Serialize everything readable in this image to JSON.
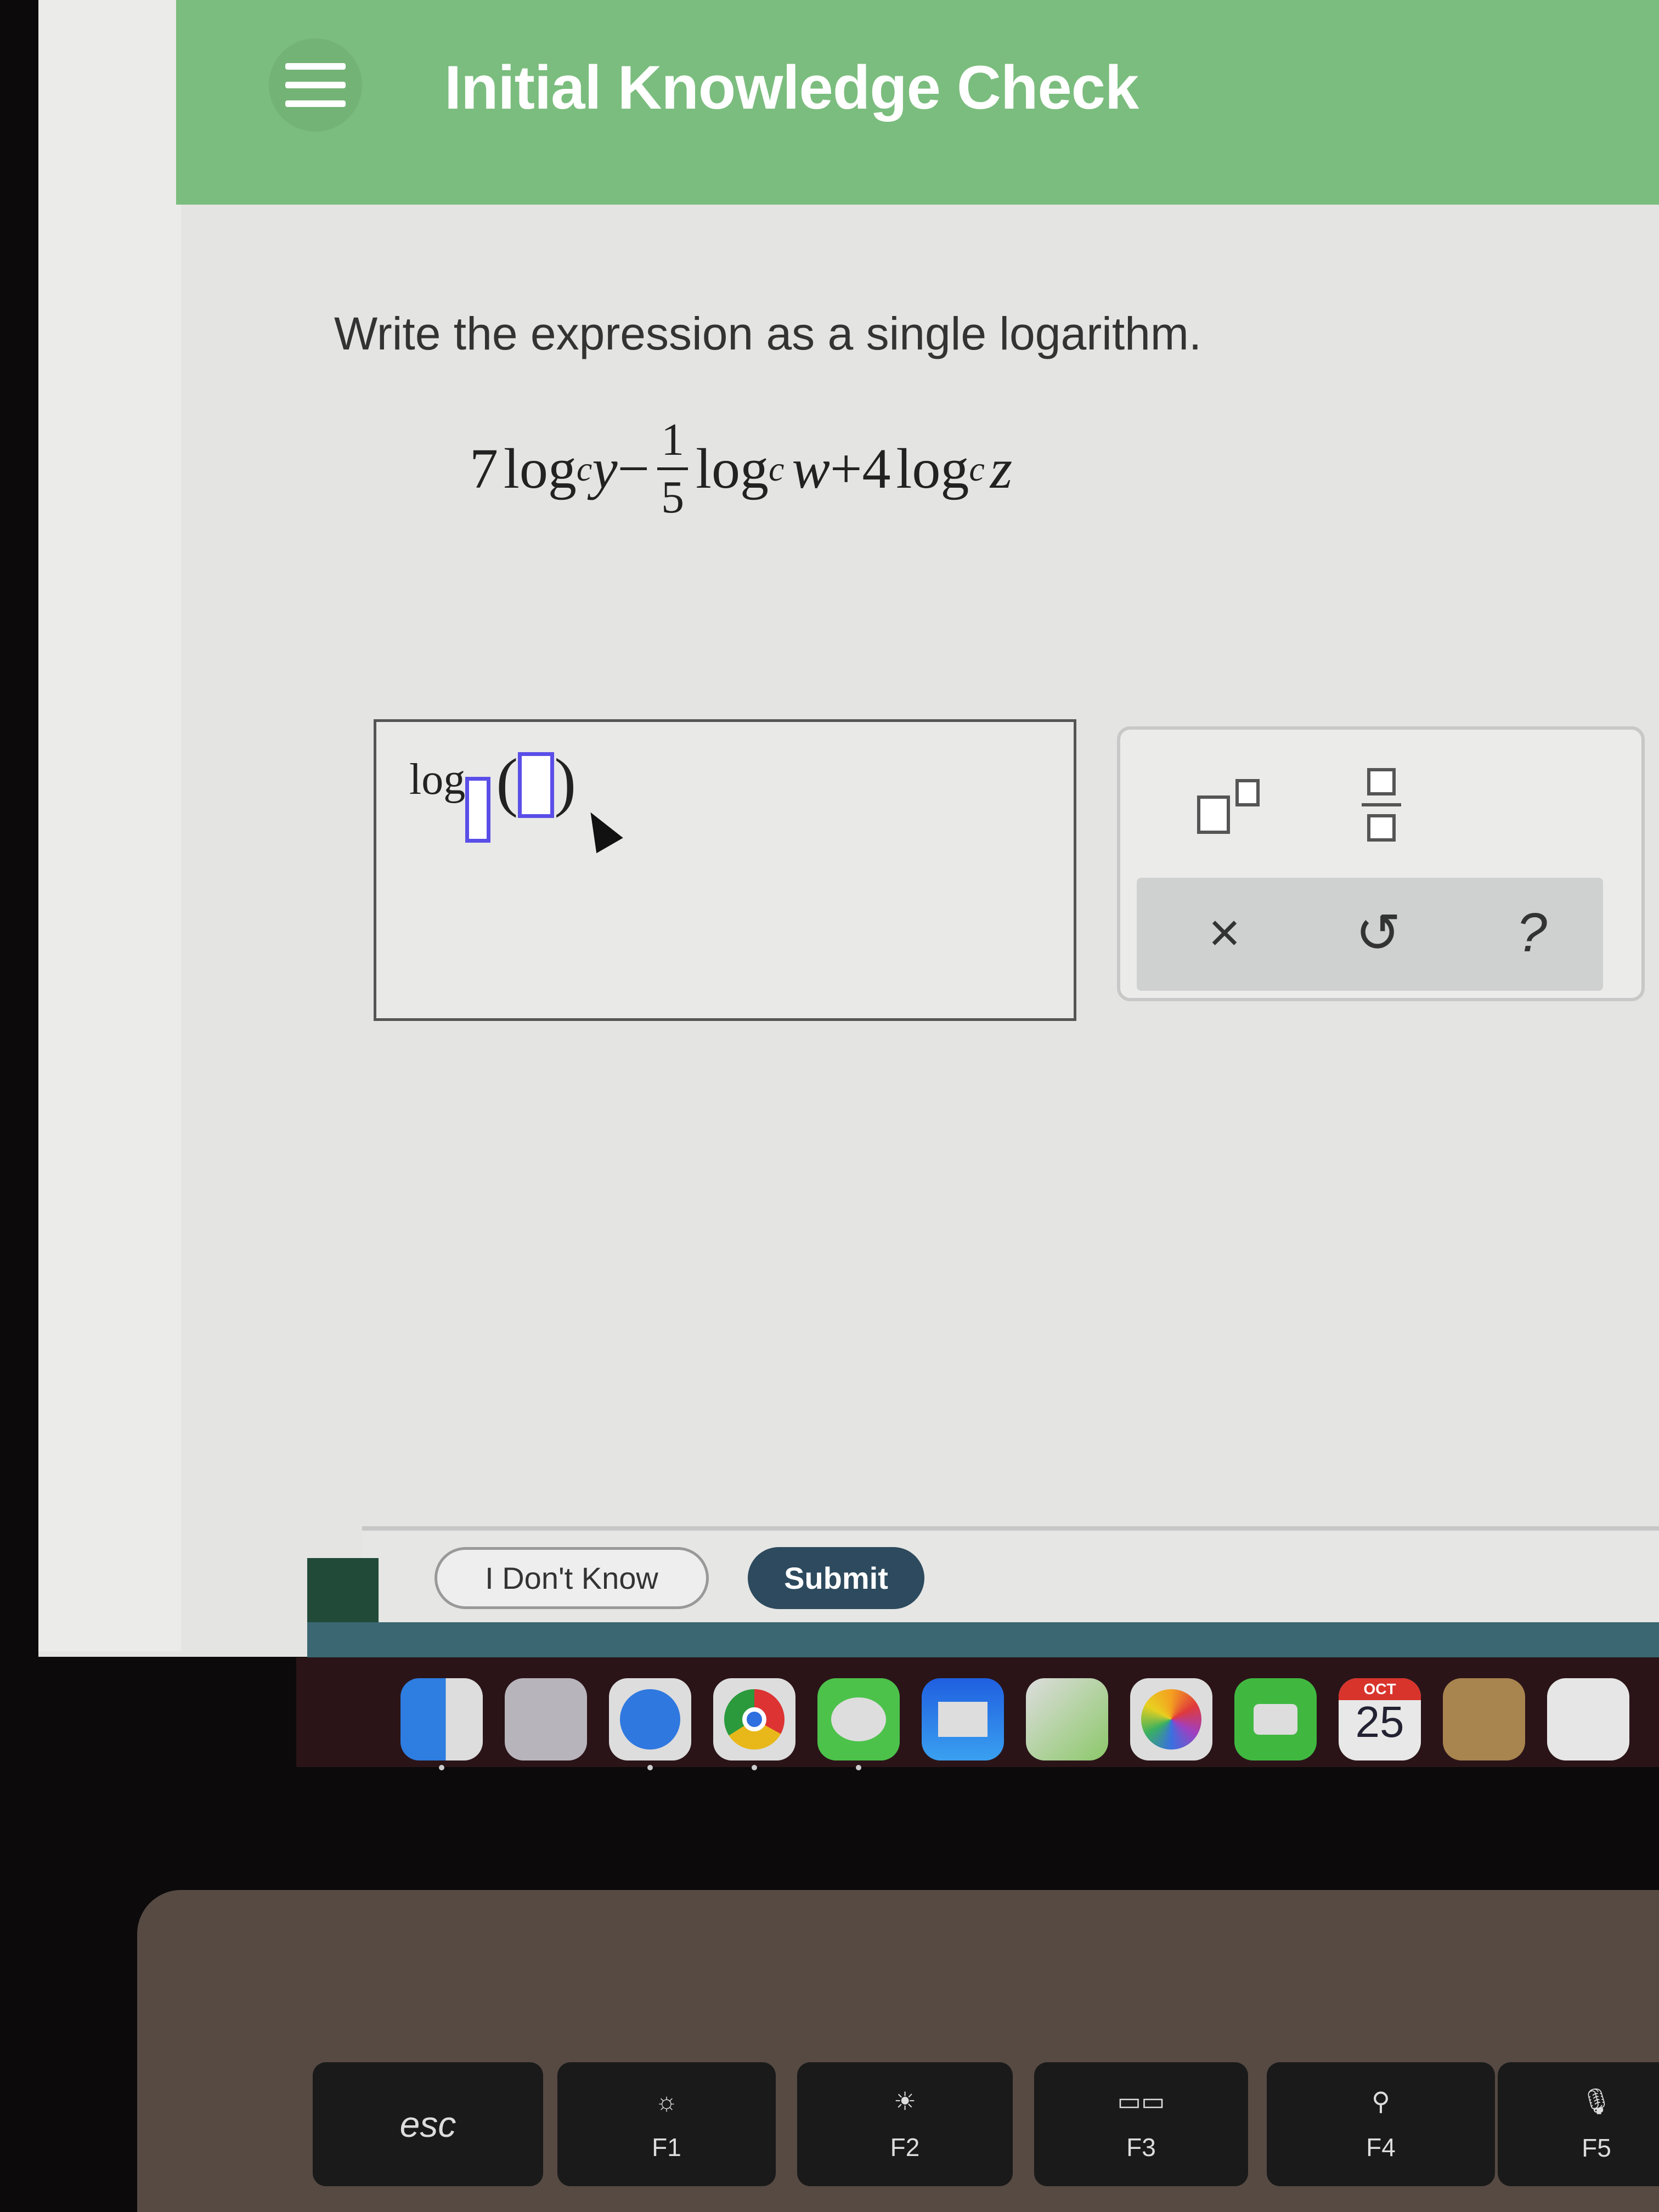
{
  "header": {
    "title": "Initial Knowledge Check",
    "menu_icon": "hamburger-icon",
    "color": "#7bbd7e"
  },
  "question": {
    "prompt": "Write the expression as a single logarithm.",
    "expression": {
      "t1_coef": "7",
      "log": "log",
      "base": "c",
      "t1_arg": "y",
      "minus": "−",
      "frac_num": "1",
      "frac_den": "5",
      "t2_arg": "w",
      "plus": "+",
      "t3_coef": "4",
      "t3_arg": "z"
    }
  },
  "answer": {
    "log_label": "log",
    "template": "log_□(□)"
  },
  "tools": {
    "superscript": "superscript-template",
    "fraction": "fraction-template",
    "clear": "×",
    "undo": "↺",
    "help": "?"
  },
  "footer": {
    "dont_know": "I Don't Know",
    "submit": "Submit",
    "submit_color": "#2d4a5e"
  },
  "dock": {
    "apps": [
      "Finder",
      "Launchpad",
      "Safari",
      "Chrome",
      "Messages",
      "Mail",
      "Maps",
      "Photos",
      "FaceTime",
      "Calendar",
      "Contacts",
      "Reminders"
    ],
    "calendar_month": "OCT",
    "calendar_day": "25"
  },
  "keyboard": {
    "keys": [
      {
        "label": "esc"
      },
      {
        "label": "F1",
        "icon": "☼"
      },
      {
        "label": "F2",
        "icon": "☀"
      },
      {
        "label": "F3",
        "icon": "▭▭"
      },
      {
        "label": "F4",
        "icon": "⚲"
      },
      {
        "label": "F5",
        "icon": "🎙"
      }
    ]
  }
}
